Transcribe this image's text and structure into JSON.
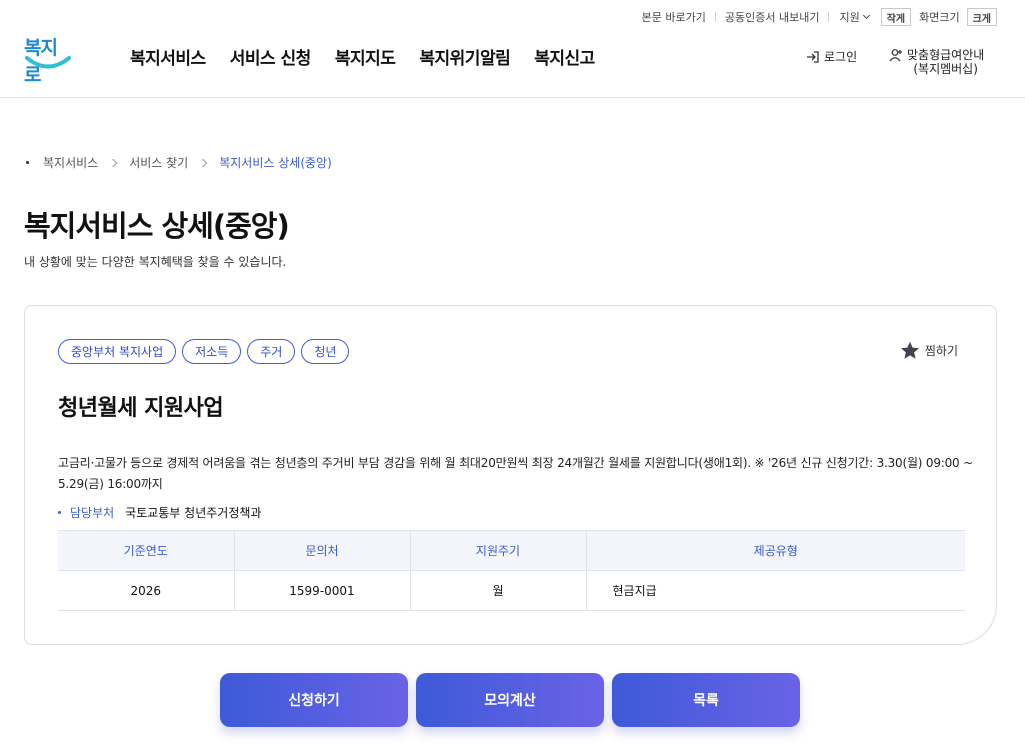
{
  "utility": {
    "skip_link": "본문 바로가기",
    "cert_export": "공동인증서 내보내기",
    "region_select": "지원",
    "font_small": "작게",
    "font_label": "화면크기",
    "font_large": "크게"
  },
  "logo": {
    "text": "복지로"
  },
  "gnb": {
    "items": [
      "복지서비스",
      "서비스 신청",
      "복지지도",
      "복지위기알림",
      "복지신고"
    ]
  },
  "account": {
    "login": "로그인",
    "member_line1": "맞춤형급여안내",
    "member_line2": "(복지멤버십)"
  },
  "breadcrumb": {
    "items": [
      "복지서비스",
      "서비스 찾기",
      "복지서비스 상세(중앙)"
    ]
  },
  "page": {
    "title": "복지서비스 상세(중앙)",
    "description": "내 상황에 맞는 다양한 복지혜택을 찾을 수 있습니다."
  },
  "service": {
    "tags": [
      "중앙부처 복지사업",
      "저소득",
      "주거",
      "청년"
    ],
    "favorite_label": "찜하기",
    "title": "청년월세 지원사업",
    "description": "고금리·고물가 등으로 경제적 어려움을 겪는 청년층의 주거비 부담 경감을 위해 월 최대20만원씩 최장 24개월간 월세를 지원합니다(생애1회). ※ '26년 신규 신청기간: 3.30(월) 09:00 ~ 5.29(금) 16:00까지",
    "department_label": "담당부처",
    "department_value": "국토교통부 청년주거정책과",
    "table": {
      "headers": [
        "기준연도",
        "문의처",
        "지원주기",
        "제공유형"
      ],
      "row": [
        "2026",
        "1599-0001",
        "월",
        "현금지급"
      ]
    }
  },
  "actions": {
    "apply": "신청하기",
    "simulate": "모의계산",
    "list": "목록"
  },
  "colors": {
    "accent": "#3b5bcf",
    "button_gradient_start": "#3d5ad8",
    "button_gradient_end": "#6a62e6"
  }
}
